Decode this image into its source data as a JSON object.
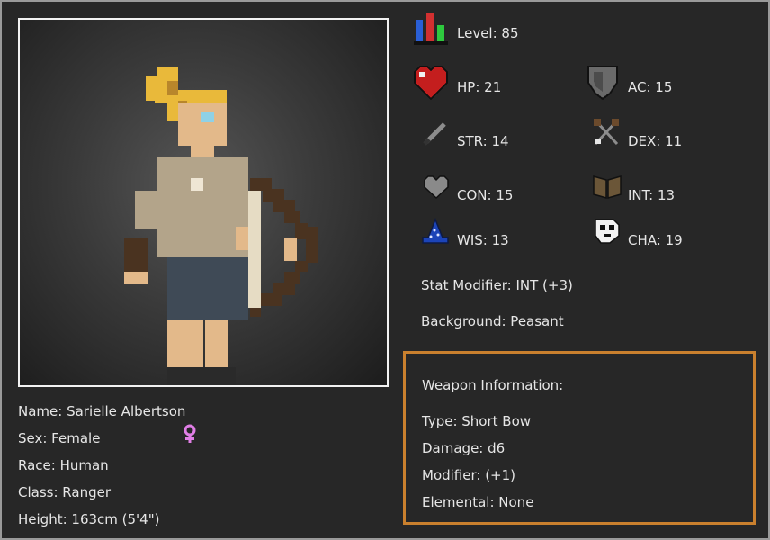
{
  "stats": {
    "level": "Level: 85",
    "hp": "HP: 21",
    "ac": "AC: 15",
    "str": "STR: 14",
    "dex": "DEX: 11",
    "con": "CON: 15",
    "int": "INT: 13",
    "wis": "WIS: 13",
    "cha": "CHA: 19"
  },
  "stat_modifier": "Stat Modifier: INT (+3)",
  "background": "Background: Peasant",
  "character": {
    "name": "Name: Sarielle Albertson",
    "sex": "Sex: Female",
    "race": "Race: Human",
    "class": "Class: Ranger",
    "height": "Height: 163cm (5'4\")"
  },
  "weapon": {
    "heading": "Weapon Information:",
    "type": "Type: Short Bow",
    "damage": "Damage: d6",
    "modifier": "Modifier: (+1)",
    "elemental": "Elemental: None"
  },
  "colors": {
    "weapon_border": "#c9802e",
    "female_symbol": "#e07ee6"
  },
  "icons": [
    "level-bars-icon",
    "heart-icon",
    "shield-icon",
    "sword-icon",
    "crossed-swords-icon",
    "grey-heart-icon",
    "spellbook-icon",
    "wizard-hat-icon",
    "mask-icon",
    "female-symbol-icon"
  ]
}
